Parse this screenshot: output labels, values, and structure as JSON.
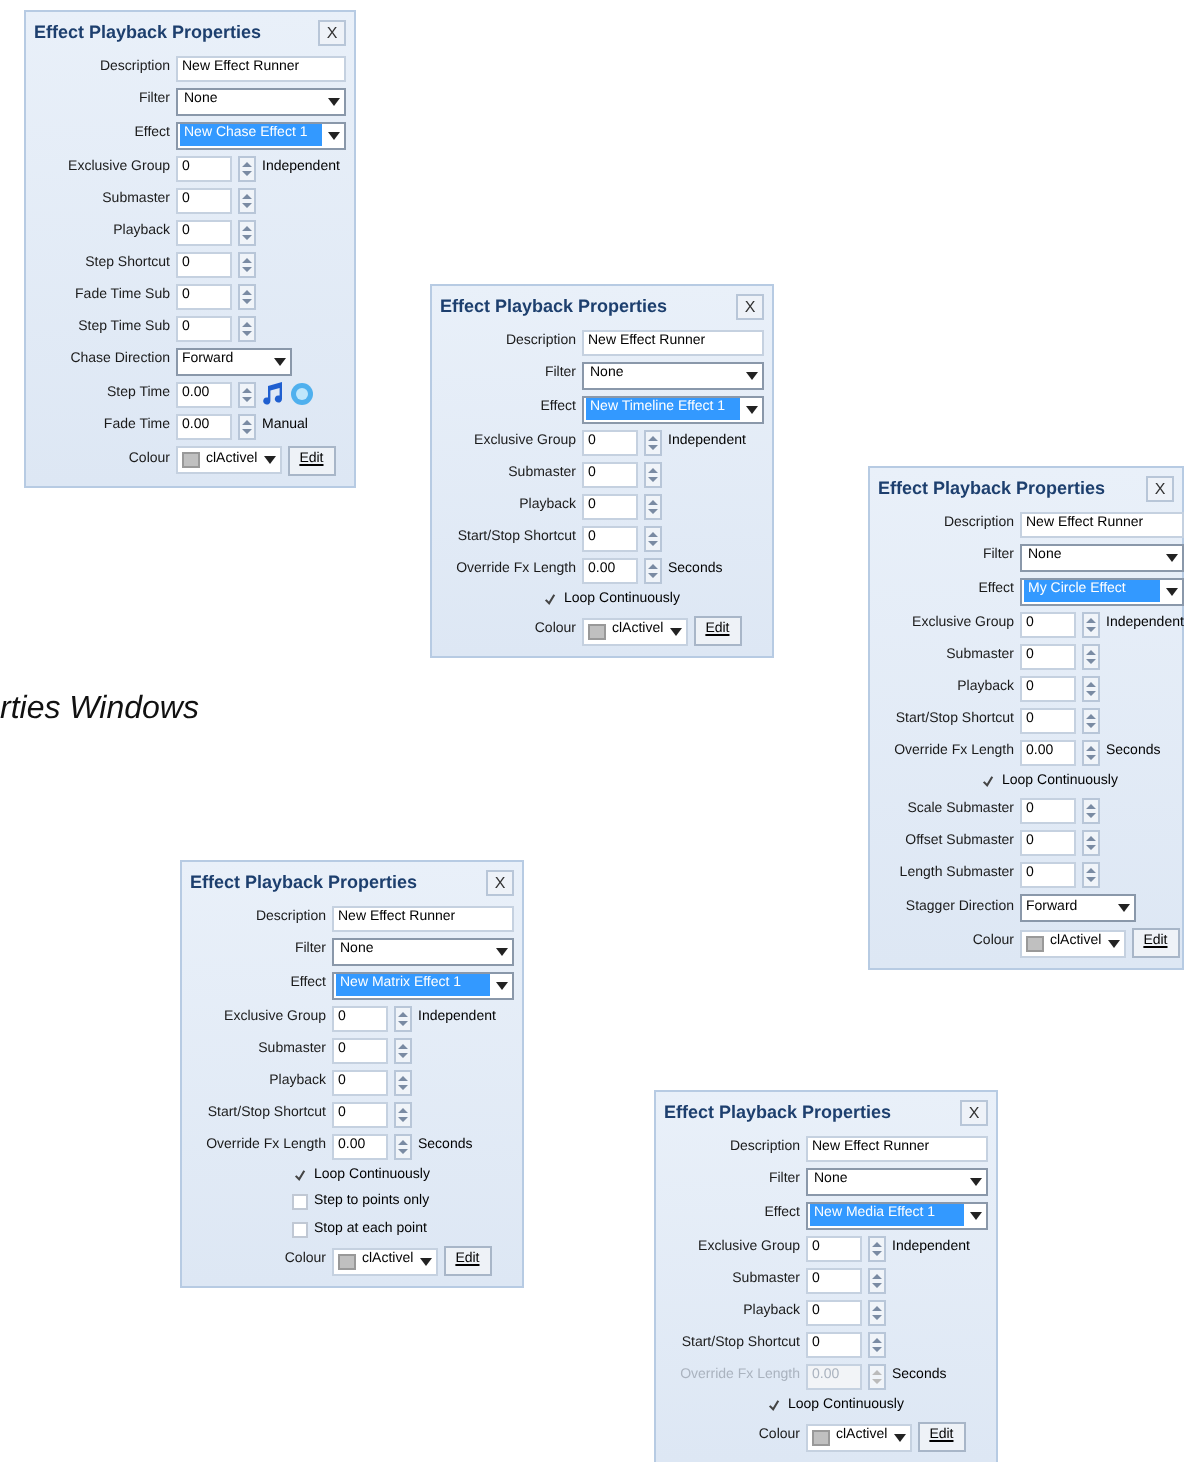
{
  "caption": "rties Windows",
  "panels": [
    {
      "title": "Effect Playback Properties",
      "close": "X",
      "rows": [
        {
          "kind": "text",
          "label": "Description",
          "value": "New Effect Runner"
        },
        {
          "kind": "select",
          "label": "Filter",
          "value": "None",
          "selected": false
        },
        {
          "kind": "select",
          "label": "Effect",
          "value": "New Chase Effect 1",
          "selected": true
        },
        {
          "kind": "spin",
          "label": "Exclusive Group",
          "value": "0",
          "suffix": "Independent",
          "disabled": false
        },
        {
          "kind": "spin",
          "label": "Submaster",
          "value": "0",
          "disabled": false
        },
        {
          "kind": "spin",
          "label": "Playback",
          "value": "0",
          "disabled": false
        },
        {
          "kind": "spin",
          "label": "Step Shortcut",
          "value": "0",
          "disabled": false
        },
        {
          "kind": "spin",
          "label": "Fade Time Sub",
          "value": "0",
          "disabled": false
        },
        {
          "kind": "spin",
          "label": "Step Time Sub",
          "value": "0",
          "disabled": false
        },
        {
          "kind": "dropdown",
          "label": "Chase Direction",
          "value": "Forward"
        },
        {
          "kind": "spin",
          "label": "Step Time",
          "value": "0.00",
          "disabled": false,
          "media_buttons": true
        },
        {
          "kind": "spin",
          "label": "Fade Time",
          "value": "0.00",
          "suffix": "Manual",
          "disabled": false
        },
        {
          "kind": "colour",
          "label": "Colour",
          "value": "clActivel",
          "button": "Edit"
        }
      ]
    },
    {
      "title": "Effect Playback Properties",
      "close": "X",
      "rows": [
        {
          "kind": "text",
          "label": "Description",
          "value": "New Effect Runner"
        },
        {
          "kind": "select",
          "label": "Filter",
          "value": "None",
          "selected": false
        },
        {
          "kind": "select",
          "label": "Effect",
          "value": "New Timeline Effect 1",
          "selected": true
        },
        {
          "kind": "spin",
          "label": "Exclusive Group",
          "value": "0",
          "suffix": "Independent",
          "disabled": false
        },
        {
          "kind": "spin",
          "label": "Submaster",
          "value": "0",
          "disabled": false
        },
        {
          "kind": "spin",
          "label": "Playback",
          "value": "0",
          "disabled": false
        },
        {
          "kind": "spin",
          "label": "Start/Stop Shortcut",
          "value": "0",
          "disabled": false
        },
        {
          "kind": "spin",
          "label": "Override Fx Length",
          "value": "0.00",
          "suffix": "Seconds",
          "disabled": false
        },
        {
          "kind": "checkbox",
          "label": "Loop Continuously",
          "checked": true
        },
        {
          "kind": "colour",
          "label": "Colour",
          "value": "clActivel",
          "button": "Edit"
        }
      ]
    },
    {
      "title": "Effect Playback Properties",
      "close": "X",
      "rows": [
        {
          "kind": "text",
          "label": "Description",
          "value": "New Effect Runner"
        },
        {
          "kind": "select",
          "label": "Filter",
          "value": "None",
          "selected": false
        },
        {
          "kind": "select",
          "label": "Effect",
          "value": "My Circle Effect",
          "selected": true
        },
        {
          "kind": "spin",
          "label": "Exclusive Group",
          "value": "0",
          "suffix": "Independent",
          "disabled": false
        },
        {
          "kind": "spin",
          "label": "Submaster",
          "value": "0",
          "disabled": false
        },
        {
          "kind": "spin",
          "label": "Playback",
          "value": "0",
          "disabled": false
        },
        {
          "kind": "spin",
          "label": "Start/Stop Shortcut",
          "value": "0",
          "disabled": false
        },
        {
          "kind": "spin",
          "label": "Override Fx Length",
          "value": "0.00",
          "suffix": "Seconds",
          "disabled": false
        },
        {
          "kind": "checkbox",
          "label": "Loop Continuously",
          "checked": true
        },
        {
          "kind": "spin",
          "label": "Scale Submaster",
          "value": "0",
          "disabled": false
        },
        {
          "kind": "spin",
          "label": "Offset Submaster",
          "value": "0",
          "disabled": false
        },
        {
          "kind": "spin",
          "label": "Length Submaster",
          "value": "0",
          "disabled": false
        },
        {
          "kind": "dropdown",
          "label": "Stagger Direction",
          "value": "Forward"
        },
        {
          "kind": "colour",
          "label": "Colour",
          "value": "clActivel",
          "button": "Edit"
        }
      ]
    },
    {
      "title": "Effect Playback Properties",
      "close": "X",
      "rows": [
        {
          "kind": "text",
          "label": "Description",
          "value": "New Effect Runner"
        },
        {
          "kind": "select",
          "label": "Filter",
          "value": "None",
          "selected": false
        },
        {
          "kind": "select",
          "label": "Effect",
          "value": "New Matrix Effect 1",
          "selected": true
        },
        {
          "kind": "spin",
          "label": "Exclusive Group",
          "value": "0",
          "suffix": "Independent",
          "disabled": false
        },
        {
          "kind": "spin",
          "label": "Submaster",
          "value": "0",
          "disabled": false
        },
        {
          "kind": "spin",
          "label": "Playback",
          "value": "0",
          "disabled": false
        },
        {
          "kind": "spin",
          "label": "Start/Stop Shortcut",
          "value": "0",
          "disabled": false
        },
        {
          "kind": "spin",
          "label": "Override Fx Length",
          "value": "0.00",
          "suffix": "Seconds",
          "disabled": false
        },
        {
          "kind": "checkbox",
          "label": "Loop Continuously",
          "checked": true
        },
        {
          "kind": "checkbox",
          "label": "Step to points only",
          "checked": false
        },
        {
          "kind": "checkbox",
          "label": "Stop at each point",
          "checked": false
        },
        {
          "kind": "colour",
          "label": "Colour",
          "value": "clActivel",
          "button": "Edit"
        }
      ]
    },
    {
      "title": "Effect Playback Properties",
      "close": "X",
      "rows": [
        {
          "kind": "text",
          "label": "Description",
          "value": "New Effect Runner"
        },
        {
          "kind": "select",
          "label": "Filter",
          "value": "None",
          "selected": false
        },
        {
          "kind": "select",
          "label": "Effect",
          "value": "New Media Effect 1",
          "selected": true
        },
        {
          "kind": "spin",
          "label": "Exclusive Group",
          "value": "0",
          "suffix": "Independent",
          "disabled": false
        },
        {
          "kind": "spin",
          "label": "Submaster",
          "value": "0",
          "disabled": false
        },
        {
          "kind": "spin",
          "label": "Playback",
          "value": "0",
          "disabled": false
        },
        {
          "kind": "spin",
          "label": "Start/Stop Shortcut",
          "value": "0",
          "disabled": false
        },
        {
          "kind": "spin",
          "label": "Override Fx Length",
          "value": "0.00",
          "suffix": "Seconds",
          "disabled": true
        },
        {
          "kind": "checkbox",
          "label": "Loop Continuously",
          "checked": true
        },
        {
          "kind": "colour",
          "label": "Colour",
          "value": "clActivel",
          "button": "Edit"
        }
      ]
    }
  ]
}
